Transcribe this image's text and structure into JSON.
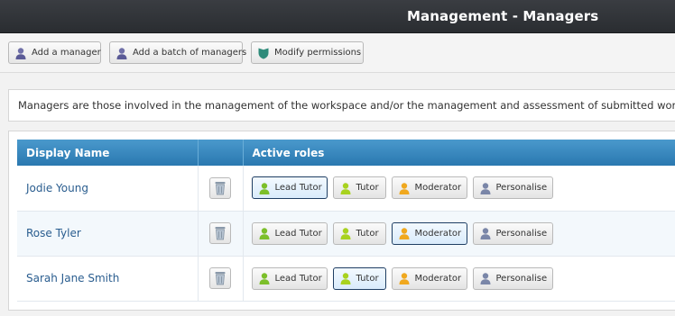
{
  "header": {
    "title": "Management - Managers"
  },
  "toolbar": {
    "add_manager": "Add a manager",
    "add_batch": "Add a batch of managers",
    "modify_permissions": "Modify permissions"
  },
  "description": "Managers are those involved in the management of the workspace and/or the management and assessment of submitted work.",
  "table": {
    "headers": {
      "display_name": "Display Name",
      "delete": "",
      "active_roles": "Active roles"
    },
    "role_labels": {
      "lead_tutor": "Lead Tutor",
      "tutor": "Tutor",
      "moderator": "Moderator",
      "personalise": "Personalise"
    },
    "rows": [
      {
        "name": "Jodie Young",
        "active_role": "lead_tutor"
      },
      {
        "name": "Rose Tyler",
        "active_role": "moderator"
      },
      {
        "name": "Sarah Jane Smith",
        "active_role": "tutor"
      }
    ]
  },
  "colors": {
    "header_bg": "#2f3236",
    "table_header": "#3a8bc2",
    "name_link": "#2a5d8f",
    "lead_tutor_icon": "#7cbf2a",
    "tutor_icon": "#a8d21f",
    "moderator_icon": "#f0a81e",
    "personalise_icon": "#7a86a8",
    "permissions_icon": "#2e8b7a"
  },
  "icons": {
    "add_manager": "person-icon",
    "add_batch": "person-icon",
    "modify_permissions": "shield-icon",
    "delete": "trash-icon"
  }
}
